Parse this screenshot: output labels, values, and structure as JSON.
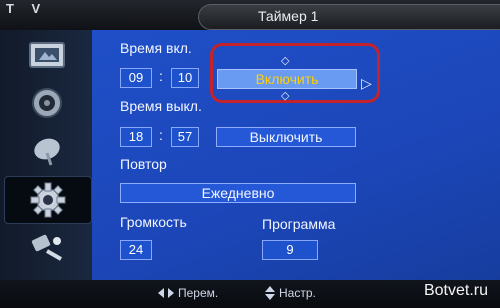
{
  "header": {
    "section": "T V",
    "title": "Таймер 1"
  },
  "sidebar": {
    "items": [
      {
        "icon": "picture-icon"
      },
      {
        "icon": "sound-icon"
      },
      {
        "icon": "channel-icon"
      },
      {
        "icon": "settings-gear-icon",
        "active": true
      },
      {
        "icon": "input-plug-icon"
      }
    ]
  },
  "timer": {
    "on_time_label": "Время вкл.",
    "on_hour": "09",
    "on_minute": "10",
    "on_state": "Включить",
    "off_time_label": "Время выкл.",
    "off_hour": "18",
    "off_minute": "57",
    "off_state": "Выключить",
    "colon": ":",
    "repeat_label": "Повтор",
    "repeat_value": "Ежедневно",
    "volume_label": "Громкость",
    "volume_value": "24",
    "program_label": "Программа",
    "program_value": "9"
  },
  "footer": {
    "move_hint": "Перем.",
    "adjust_hint": "Настр.",
    "watermark": "Botvet.ru"
  },
  "colors": {
    "panel": "#1f4fc8",
    "focus": "#c3232a",
    "selected_text": "#ffd000"
  }
}
